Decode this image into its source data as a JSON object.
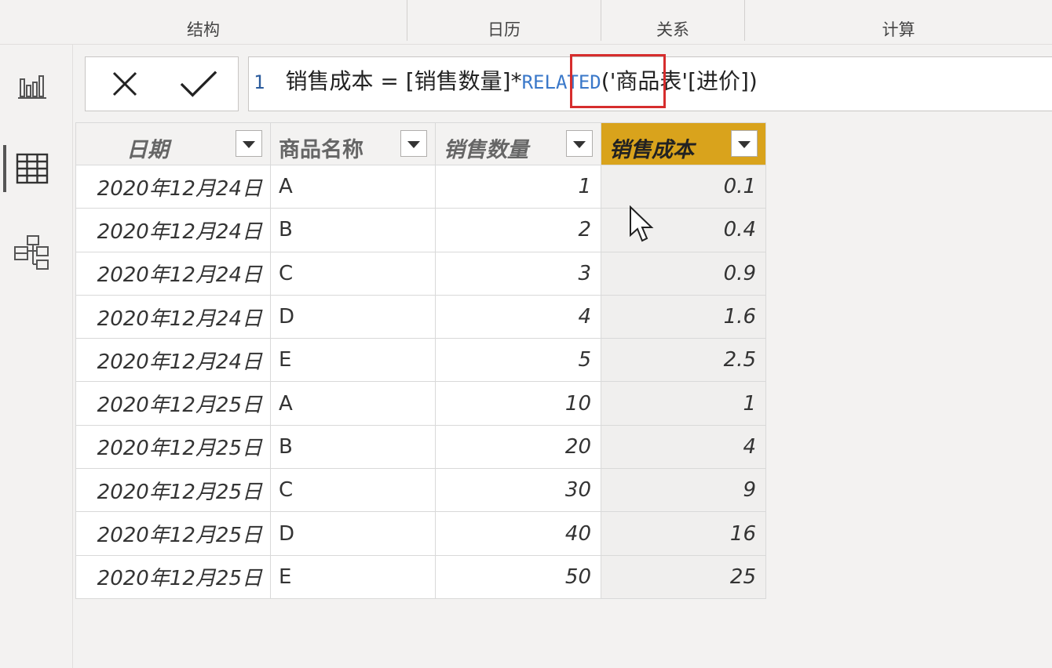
{
  "ribbon": {
    "groups": [
      "结构",
      "日历",
      "关系",
      "计算"
    ]
  },
  "views": [
    {
      "name": "report-view",
      "icon": "bar-chart-icon"
    },
    {
      "name": "data-view",
      "icon": "table-icon",
      "active": true
    },
    {
      "name": "model-view",
      "icon": "model-icon"
    }
  ],
  "formula": {
    "line_number": "1",
    "measure": "销售成本",
    "equals": "=",
    "ref": "[销售数量]*",
    "func": "RELATED",
    "args": "('商品表'[进价])",
    "cancel_icon": "close-icon",
    "commit_icon": "checkmark-icon"
  },
  "table": {
    "columns": [
      "日期",
      "商品名称",
      "销售数量",
      "销售成本"
    ],
    "selected_column": "销售成本",
    "rows": [
      [
        "2020年12月24日",
        "A",
        "1",
        "0.1"
      ],
      [
        "2020年12月24日",
        "B",
        "2",
        "0.4"
      ],
      [
        "2020年12月24日",
        "C",
        "3",
        "0.9"
      ],
      [
        "2020年12月24日",
        "D",
        "4",
        "1.6"
      ],
      [
        "2020年12月24日",
        "E",
        "5",
        "2.5"
      ],
      [
        "2020年12月25日",
        "A",
        "10",
        "1"
      ],
      [
        "2020年12月25日",
        "B",
        "20",
        "4"
      ],
      [
        "2020年12月25日",
        "C",
        "30",
        "9"
      ],
      [
        "2020年12月25日",
        "D",
        "40",
        "16"
      ],
      [
        "2020年12月25日",
        "E",
        "50",
        "25"
      ]
    ]
  },
  "colors": {
    "selected_header": "#d9a31c",
    "highlight_box": "#d62d2d",
    "keyword": "#3a78c9"
  }
}
